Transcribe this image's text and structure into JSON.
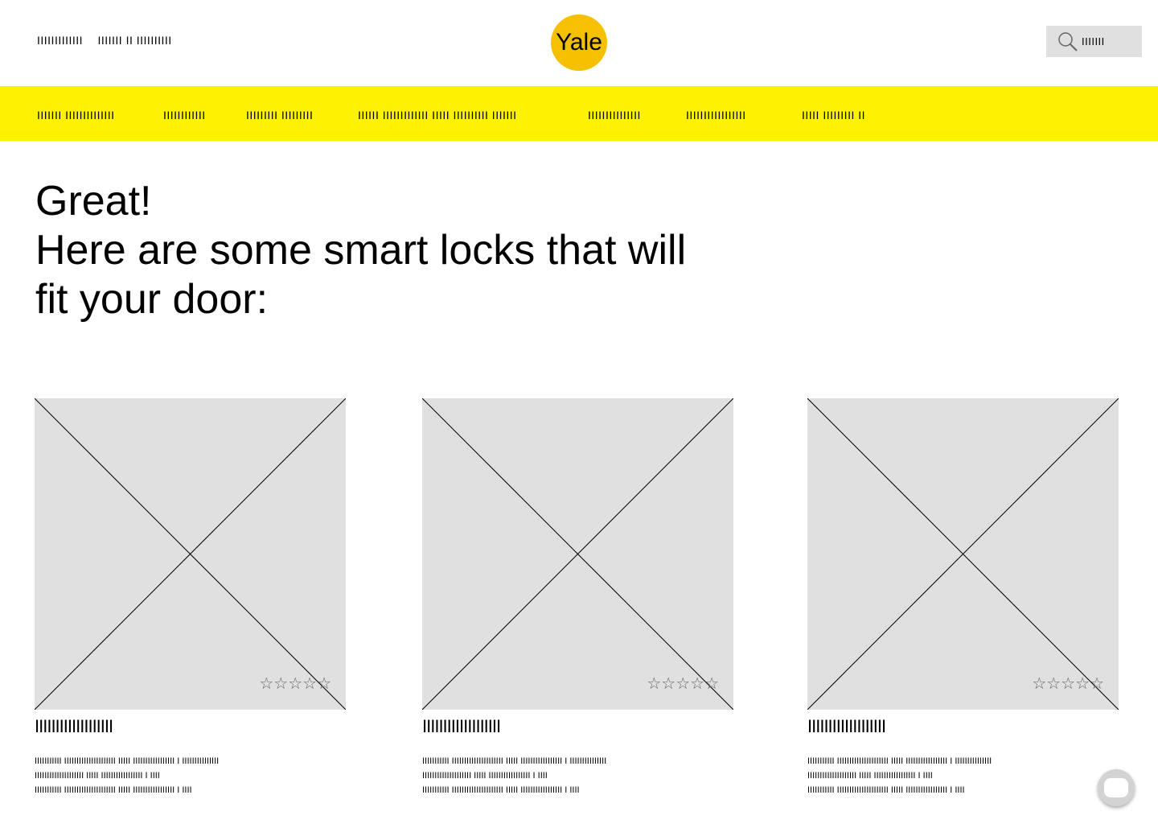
{
  "header": {
    "left_links": [
      "IIIIIIIIIIIII",
      "IIIIIII II IIIIIIIIII"
    ],
    "logo_text": "Yale",
    "search": {
      "icon": "search-icon",
      "placeholder": "IIIIIII"
    }
  },
  "nav": {
    "items": [
      "IIIIIII IIIIIIIIIIIIII",
      "IIIIIIIIIIII",
      "IIIIIIIII IIIIIIIII",
      "IIIIII IIIIIIIIIIIII IIIII IIIIIIIIII IIIIIII",
      "IIIIIIIIIIIIIII",
      "IIIIIIIIIIIIIIIII",
      "IIIII IIIIIIIII II"
    ]
  },
  "main": {
    "heading_line1": "Great!",
    "heading_line2": "Here are some smart locks that will",
    "heading_line3": "fit your door:"
  },
  "products": [
    {
      "rating": 0,
      "stars": "☆☆☆☆☆",
      "title": "IIIIIIIIIIIIIIIIIII",
      "desc_lines": [
        "IIIIIIIIIII IIIIIIIIIIIIIIIIIIIII IIIII  IIIIIIIIIIIIIIIII  I IIIIIIIIIIIIIII",
        "IIIIIIIIIIIIIIIIIIII IIIII  IIIIIIIIIIIIIIIII  I IIII",
        "IIIIIIIIIII IIIIIIIIIIIIIIIIIIIII IIIII  IIIIIIIIIIIIIIIII  I IIII"
      ]
    },
    {
      "rating": 0,
      "stars": "☆☆☆☆☆",
      "title": "IIIIIIIIIIIIIIIIIII",
      "desc_lines": [
        "IIIIIIIIIII IIIIIIIIIIIIIIIIIIIII IIIII  IIIIIIIIIIIIIIIII  I IIIIIIIIIIIIIII",
        "IIIIIIIIIIIIIIIIIIII IIIII  IIIIIIIIIIIIIIIII  I IIII",
        "IIIIIIIIIII IIIIIIIIIIIIIIIIIIIII IIIII  IIIIIIIIIIIIIIIII  I IIII"
      ]
    },
    {
      "rating": 0,
      "stars": "☆☆☆☆☆",
      "title": "IIIIIIIIIIIIIIIIIII",
      "desc_lines": [
        "IIIIIIIIIII IIIIIIIIIIIIIIIIIIIII IIIII  IIIIIIIIIIIIIIIII  I IIIIIIIIIIIIIII",
        "IIIIIIIIIIIIIIIIIIII IIIII  IIIIIIIIIIIIIIIII  I IIII",
        "IIIIIIIIIII IIIIIIIIIIIIIIIIIIIII IIIII  IIIIIIIIIIIIIIIII  I IIII"
      ]
    }
  ],
  "chat": {
    "icon": "chat-bubble-icon"
  },
  "colors": {
    "nav_bg": "#FFF200",
    "logo_bg": "#F5C000",
    "placeholder_bg": "#E0E0E0"
  }
}
